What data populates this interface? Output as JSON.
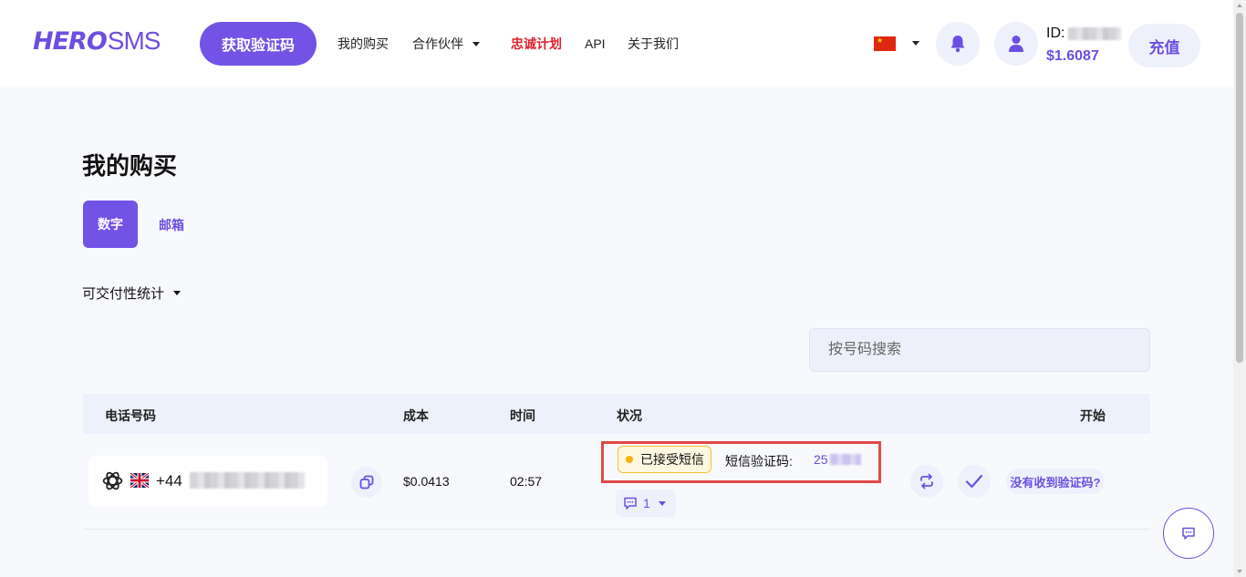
{
  "header": {
    "logo_left": "HERO",
    "logo_right": "SMS",
    "get_code_label": "获取验证码",
    "nav": {
      "purchases": "我的购买",
      "partners": "合作伙伴",
      "loyalty": "忠诚计划",
      "api": "API",
      "about": "关于我们"
    },
    "user_id_prefix": "ID: ",
    "balance": "$1.6087",
    "topup_label": "充值"
  },
  "main": {
    "title": "我的购买",
    "tabs": [
      "数字",
      "邮箱"
    ],
    "stats_label": "可交付性统计",
    "search_placeholder": "按号码搜索"
  },
  "table": {
    "headers": {
      "phone": "电话号码",
      "cost": "成本",
      "time": "时间",
      "status": "状况",
      "start": "开始"
    },
    "rows": [
      {
        "phone_prefix": "+44",
        "cost": "$0.0413",
        "time": "02:57",
        "status": "已接受短信",
        "sms_label": "短信验证码:",
        "sms_code": "25",
        "message_count": "1",
        "no_code_label": "没有收到验证码?"
      }
    ]
  },
  "colors": {
    "accent": "#7253e6",
    "loyalty_red": "#e0202c",
    "highlight_red": "#e14848",
    "status_yellow": "#f4b400"
  },
  "icons": [
    "bell-icon",
    "user-icon",
    "copy-icon",
    "openai-icon",
    "uk-flag-icon",
    "cn-flag-icon",
    "replace-icon",
    "check-icon",
    "chat-icon",
    "caret-down-icon"
  ]
}
